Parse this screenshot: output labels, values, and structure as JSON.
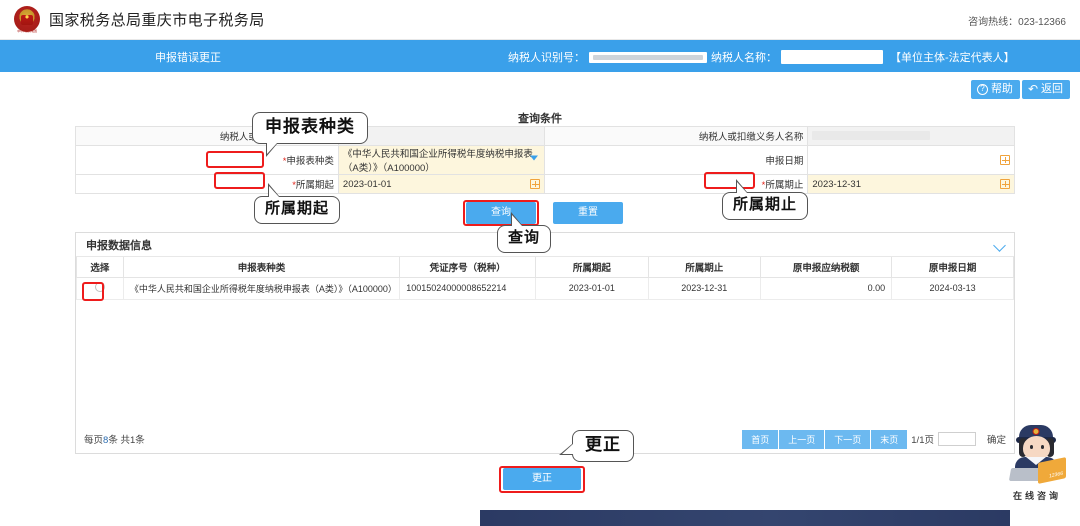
{
  "header": {
    "site_title": "国家税务总局重庆市电子税务局",
    "emblem_text": "中华人民共和国",
    "hotline": "咨询热线：023-12366"
  },
  "navband": {
    "module_name": "申报错误更正",
    "taxpayer_id_label": "纳税人识别号：",
    "taxpayer_name_label": "纳税人名称：",
    "role_tag": "【单位主体-法定代表人】"
  },
  "toolbar": {
    "help_label": "帮助",
    "help_icon": "question-circle-icon",
    "back_label": "返回",
    "back_icon": "arrow-back-icon"
  },
  "query": {
    "section_title": "查询条件",
    "fields": {
      "taxpayer_id_label": "纳税人或扣缴义务人识别号",
      "taxpayer_id_value": "",
      "taxpayer_name_label": "纳税人或扣缴义务人名称",
      "taxpayer_name_value": "",
      "form_type_label": "申报表种类",
      "form_type_required": "*",
      "form_type_value": "《中华人民共和国企业所得税年度纳税申报表（A类）》（A100000）",
      "declare_date_label": "申报日期",
      "declare_date_value": "",
      "period_start_label": "所属期起",
      "period_start_required": "*",
      "period_start_value": "2023-01-01",
      "period_end_label": "所属期止",
      "period_end_required": "*",
      "period_end_value": "2023-12-31"
    },
    "buttons": {
      "query_label": "查询",
      "reset_label": "重置"
    }
  },
  "panel": {
    "title": "申报数据信息",
    "collapse_icon": "chevron-down-icon",
    "columns": [
      "选择",
      "申报表种类",
      "凭证序号（税种）",
      "所属期起",
      "所属期止",
      "原申报应纳税额",
      "原申报日期"
    ],
    "rows": [
      {
        "selected": false,
        "form_type": "《中华人民共和国企业所得税年度纳税申报表（A类）》（A100000）",
        "voucher_no": "10015024000008652214",
        "period_start": "2023-01-01",
        "period_end": "2023-12-31",
        "original_tax_amount": "0.00",
        "original_declare_date": "2024-03-13"
      }
    ],
    "pager": {
      "per_page_prefix": "每页",
      "per_page_size": "8",
      "per_page_suffix": "条",
      "total_text": "共1条",
      "first_label": "首页",
      "prev_label": "上一页",
      "next_label": "下一页",
      "last_label": "末页",
      "page_indicator": "1/1页",
      "jump_value": "",
      "confirm_label": "确定"
    }
  },
  "footer_buttons": {
    "correct_label": "更正"
  },
  "annotations": [
    {
      "text": "申报表种类"
    },
    {
      "text": "所属期起"
    },
    {
      "text": "所属期止"
    },
    {
      "text": "查询"
    },
    {
      "text": "更正"
    }
  ],
  "mascot": {
    "label": "在线咨询",
    "screen_text": "12366"
  }
}
